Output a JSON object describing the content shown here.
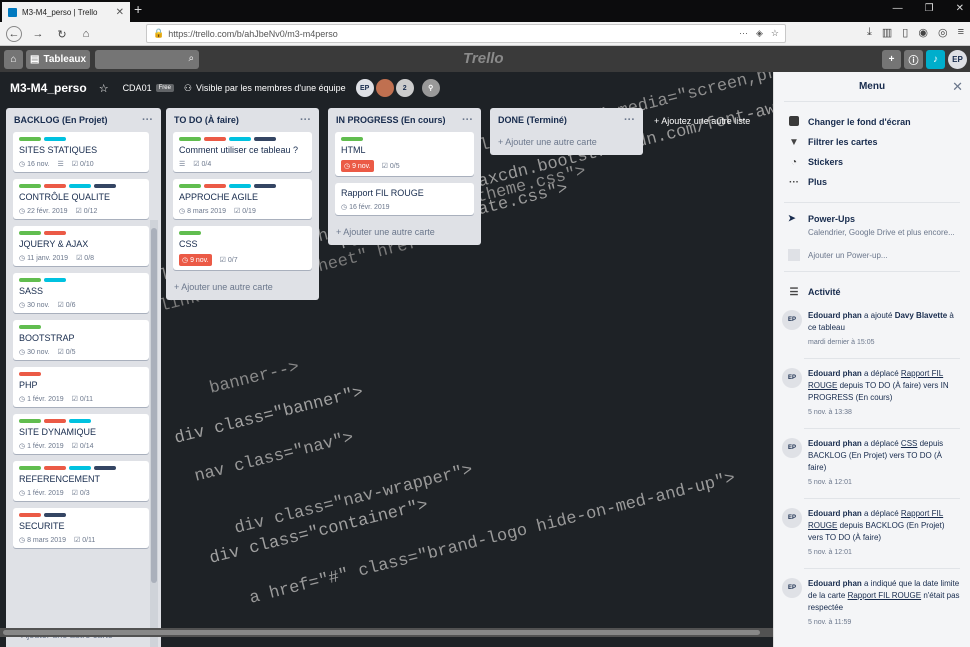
{
  "browser": {
    "tab_title": "M3-M4_perso | Trello",
    "url": "https://trello.com/b/ahJbeNv0/m3-m4perso"
  },
  "header": {
    "boards_label": "Tableaux",
    "logo": "Trello",
    "avatar": "EP"
  },
  "board": {
    "title": "M3-M4_perso",
    "team": "CDA01",
    "team_badge": "Free",
    "visibility": "Visible par les membres d'une équipe",
    "members": [
      "EP",
      "2"
    ],
    "add_list": "+ Ajoutez une autre liste"
  },
  "lists": [
    {
      "title": "BACKLOG (En Projet)",
      "add": "+ Ajouter une autre carte",
      "cards": [
        {
          "title": "SITES STATIQUES",
          "labels": [
            "#61bd4f",
            "#00c2e0"
          ],
          "date": "16 nov.",
          "desc": true,
          "check": "0/10"
        },
        {
          "title": "CONTRÔLE QUALITE",
          "labels": [
            "#61bd4f",
            "#eb5a46",
            "#00c2e0",
            "#344563"
          ],
          "date": "22 févr. 2019",
          "check": "0/12"
        },
        {
          "title": "JQUERY & AJAX",
          "labels": [
            "#61bd4f",
            "#eb5a46"
          ],
          "date": "11 janv. 2019",
          "check": "0/8"
        },
        {
          "title": "SASS",
          "labels": [
            "#61bd4f",
            "#00c2e0"
          ],
          "date": "30 nov.",
          "check": "0/6"
        },
        {
          "title": "BOOTSTRAP",
          "labels": [
            "#61bd4f"
          ],
          "date": "30 nov.",
          "check": "0/5"
        },
        {
          "title": "PHP",
          "labels": [
            "#eb5a46"
          ],
          "date": "1 févr. 2019",
          "check": "0/11"
        },
        {
          "title": "SITE DYNAMIQUE",
          "labels": [
            "#61bd4f",
            "#eb5a46",
            "#00c2e0"
          ],
          "date": "1 févr. 2019",
          "check": "0/14"
        },
        {
          "title": "REFERENCEMENT",
          "labels": [
            "#61bd4f",
            "#eb5a46",
            "#00c2e0",
            "#344563"
          ],
          "date": "1 févr. 2019",
          "check": "0/3"
        },
        {
          "title": "SECURITE",
          "labels": [
            "#eb5a46",
            "#344563"
          ],
          "date": "8 mars 2019",
          "check": "0/11"
        }
      ]
    },
    {
      "title": "TO DO (À faire)",
      "add": "+ Ajouter une autre carte",
      "cards": [
        {
          "title": "Comment utiliser ce tableau ?",
          "labels": [
            "#61bd4f",
            "#eb5a46",
            "#00c2e0",
            "#344563"
          ],
          "desc": true,
          "check": "0/4"
        },
        {
          "title": "APPROCHE AGILE",
          "labels": [
            "#61bd4f",
            "#eb5a46",
            "#00c2e0",
            "#344563"
          ],
          "date": "8 mars 2019",
          "check": "0/19"
        },
        {
          "title": "CSS",
          "labels": [
            "#61bd4f"
          ],
          "due": "9 nov.",
          "check": "0/7"
        }
      ]
    },
    {
      "title": "IN PROGRESS (En cours)",
      "add": "+ Ajouter une autre carte",
      "cards": [
        {
          "title": "HTML",
          "labels": [
            "#61bd4f"
          ],
          "due": "9 nov.",
          "check": "0/5"
        },
        {
          "title": "Rapport FIL ROUGE",
          "labels": [],
          "date": "16 févr. 2019"
        }
      ]
    },
    {
      "title": "DONE (Terminé)",
      "add": "+ Ajouter une autre carte",
      "cards": []
    }
  ],
  "menu": {
    "title": "Menu",
    "items": [
      "Changer le fond d'écran",
      "Filtrer les cartes",
      "Stickers",
      "Plus"
    ],
    "powerups_title": "Power-Ups",
    "powerups_desc": "Calendrier, Google Drive et plus encore...",
    "powerups_add": "Ajouter un Power-up...",
    "activity_title": "Activité",
    "activities": [
      {
        "avatar": "EP",
        "actor": "Edouard phan",
        "pre": " a ajouté ",
        "bold": "Davy Blavette",
        "post": " à ce tableau",
        "time": "mardi dernier à 15:05"
      },
      {
        "avatar": "EP",
        "actor": "Edouard phan",
        "pre": " a déplacé ",
        "link": "Rapport FIL ROUGE",
        "post": " depuis TO DO (À faire) vers IN PROGRESS (En cours)",
        "time": "5 nov. à 13:38"
      },
      {
        "avatar": "EP",
        "actor": "Edouard phan",
        "pre": " a déplacé ",
        "link": "CSS",
        "post": " depuis BACKLOG (En Projet) vers TO DO (À faire)",
        "time": "5 nov. à 12:01"
      },
      {
        "avatar": "EP",
        "actor": "Edouard phan",
        "pre": " a déplacé ",
        "link": "Rapport FIL ROUGE",
        "post": " depuis BACKLOG (En Projet) vers TO DO (À faire)",
        "time": "5 nov. à 12:01"
      },
      {
        "avatar": "EP",
        "actor": "Edouard phan",
        "pre": " a indiqué que la date limite de la carte ",
        "link": "Rapport FIL ROUGE",
        "post": " n'était pas respectée",
        "time": "5 nov. à 11:59"
      }
    ]
  },
  "code_lines": [
    "alize.min.css\" media=\"screen,projection\"",
    "ref=\"https://maxcdn.bootstrapcdn.com/font-awesome/4.7",
    "ref=\"/css/animate.css\">",
    "link rel=\"stylesheet\" href=\"css/theme.css\">",
    "link rel=\"stylesheet\" href",
    "banner-->",
    "div class=\"banner\">",
    "nav class=\"nav\">",
    "div class=\"nav-wrapper\">",
    "div class=\"container\">",
    "a href=\"#\" class=\"brand-logo hide-on-med-and-up\">"
  ]
}
